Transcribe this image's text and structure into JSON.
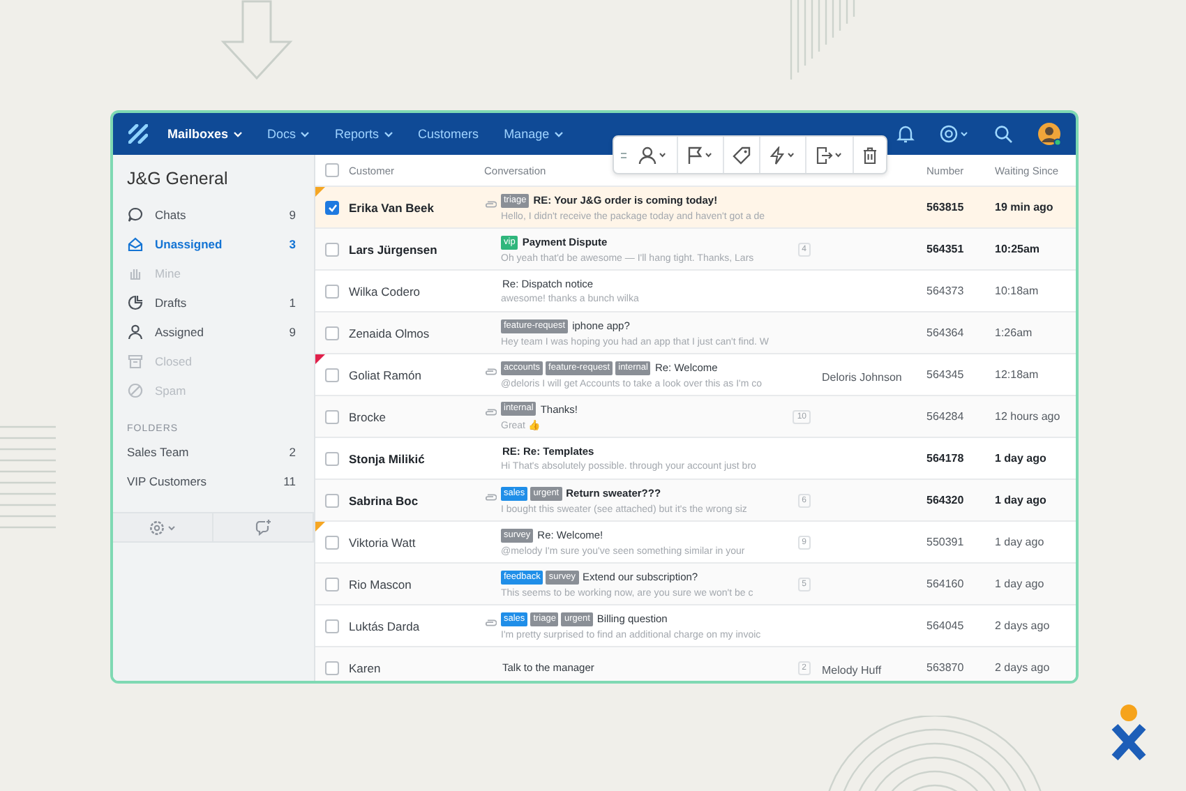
{
  "nav": {
    "items": [
      {
        "label": "Mailboxes",
        "selected": true,
        "dropdown": true
      },
      {
        "label": "Docs",
        "selected": false,
        "dropdown": true
      },
      {
        "label": "Reports",
        "selected": false,
        "dropdown": true
      },
      {
        "label": "Customers",
        "selected": false,
        "dropdown": false
      },
      {
        "label": "Manage",
        "selected": false,
        "dropdown": true
      }
    ]
  },
  "sidebar": {
    "title": "J&G General",
    "items": [
      {
        "label": "Chats",
        "count": "9",
        "selected": false,
        "disabled": false
      },
      {
        "label": "Unassigned",
        "count": "3",
        "selected": true,
        "disabled": false
      },
      {
        "label": "Mine",
        "selected": false,
        "disabled": true
      },
      {
        "label": "Drafts",
        "count": "1",
        "selected": false,
        "disabled": false
      },
      {
        "label": "Assigned",
        "count": "9",
        "selected": false,
        "disabled": false
      },
      {
        "label": "Closed",
        "selected": false,
        "disabled": true
      },
      {
        "label": "Spam",
        "selected": false,
        "disabled": true
      }
    ],
    "folders_heading": "FOLDERS",
    "folders": [
      {
        "label": "Sales Team",
        "count": "2"
      },
      {
        "label": "VIP Customers",
        "count": "11"
      }
    ]
  },
  "table": {
    "all_selected": false,
    "columns": [
      "Customer",
      "Conversation",
      "Number",
      "Waiting Since"
    ],
    "rows": [
      {
        "customer": "Erika Van Beek",
        "selected": true,
        "unread": true,
        "flag": {
          "color": "#f5a623"
        },
        "attachment": true,
        "tags": [
          {
            "label": "triage",
            "color": "#8a8f96"
          }
        ],
        "subject": "RE: Your J&G order is coming today!",
        "preview": "Hello, I didn't receive the package today and haven't got a de",
        "number": "563815",
        "waiting": "19 min ago"
      },
      {
        "customer": "Lars Jürgensen",
        "selected": false,
        "unread": true,
        "attachment": false,
        "tags": [
          {
            "label": "vip",
            "color": "#2fb67c"
          }
        ],
        "subject": "Payment Dispute",
        "preview": "Oh yeah that'd be awesome — I'll hang tight. Thanks, Lars",
        "count": "4",
        "number": "564351",
        "waiting": "10:25am"
      },
      {
        "customer": "Wilka Codero",
        "selected": false,
        "unread": false,
        "attachment": false,
        "tags": [],
        "subject": "Re: Dispatch notice",
        "preview": "awesome! thanks a bunch wilka",
        "number": "564373",
        "waiting": "10:18am"
      },
      {
        "customer": "Zenaida Olmos",
        "selected": false,
        "unread": false,
        "attachment": false,
        "tags": [
          {
            "label": "feature-request",
            "color": "#8a8f96"
          }
        ],
        "subject": "iphone app?",
        "preview": "Hey team I was hoping you had an app that I just can't find. W",
        "number": "564364",
        "waiting": "1:26am"
      },
      {
        "customer": "Goliat Ramón",
        "selected": false,
        "unread": false,
        "flag": {
          "color": "#e0204a"
        },
        "attachment": true,
        "tags": [
          {
            "label": "accounts",
            "color": "#8a8f96"
          },
          {
            "label": "feature-request",
            "color": "#8a8f96"
          },
          {
            "label": "internal",
            "color": "#8a8f96"
          }
        ],
        "subject": "Re: Welcome",
        "preview": "@deloris I will get Accounts to take a look over this as I'm co",
        "assignee": "Deloris Johnson",
        "number": "564345",
        "waiting": "12:18am"
      },
      {
        "customer": "Brocke",
        "selected": false,
        "unread": false,
        "attachment": true,
        "tags": [
          {
            "label": "internal",
            "color": "#8a8f96"
          }
        ],
        "subject": "Thanks!",
        "preview": "Great 👍",
        "count": "10",
        "number": "564284",
        "waiting": "12 hours ago"
      },
      {
        "customer": "Stonja Milikić",
        "selected": false,
        "unread": true,
        "attachment": false,
        "tags": [],
        "subject": "RE: Re: Templates",
        "preview": "Hi That's absolutely possible. through your account just bro",
        "number": "564178",
        "waiting": "1  day ago"
      },
      {
        "customer": "Sabrina Boc",
        "selected": false,
        "unread": true,
        "attachment": true,
        "tags": [
          {
            "label": "sales",
            "color": "#1f8ee8"
          },
          {
            "label": "urgent",
            "color": "#8a8f96"
          }
        ],
        "subject": "Return sweater???",
        "preview": "I bought this sweater (see attached) but it's the wrong siz",
        "count": "6",
        "number": "564320",
        "waiting": "1 day ago"
      },
      {
        "customer": "Viktoria Watt",
        "selected": false,
        "unread": false,
        "flag": {
          "color": "#f5a623"
        },
        "attachment": false,
        "tags": [
          {
            "label": "survey",
            "color": "#8a8f96"
          }
        ],
        "subject": "Re: Welcome!",
        "preview": "@melody I'm sure you've seen something similar in your",
        "count": "9",
        "number": "550391",
        "waiting": "1 day ago"
      },
      {
        "customer": "Rio Mascon",
        "selected": false,
        "unread": false,
        "attachment": false,
        "tags": [
          {
            "label": "feedback",
            "color": "#1f8ee8"
          },
          {
            "label": "survey",
            "color": "#8a8f96"
          }
        ],
        "subject": "Extend our subscription?",
        "preview": "This seems to be working now, are you sure we won't be c",
        "count": "5",
        "number": "564160",
        "waiting": "1 day ago"
      },
      {
        "customer": "Luktás Darda",
        "selected": false,
        "unread": false,
        "attachment": true,
        "tags": [
          {
            "label": "sales",
            "color": "#1f8ee8"
          },
          {
            "label": "triage",
            "color": "#8a8f96"
          },
          {
            "label": "urgent",
            "color": "#8a8f96"
          }
        ],
        "subject": "Billing question",
        "preview": "I'm pretty surprised to find an additional charge on my invoic",
        "number": "564045",
        "waiting": "2 days ago"
      },
      {
        "customer": "Karen",
        "selected": false,
        "unread": false,
        "attachment": false,
        "tags": [],
        "subject": "Talk to the manager",
        "count": "2",
        "assignee": "Melody Huff",
        "number": "563870",
        "waiting": "2 days ago"
      }
    ]
  }
}
